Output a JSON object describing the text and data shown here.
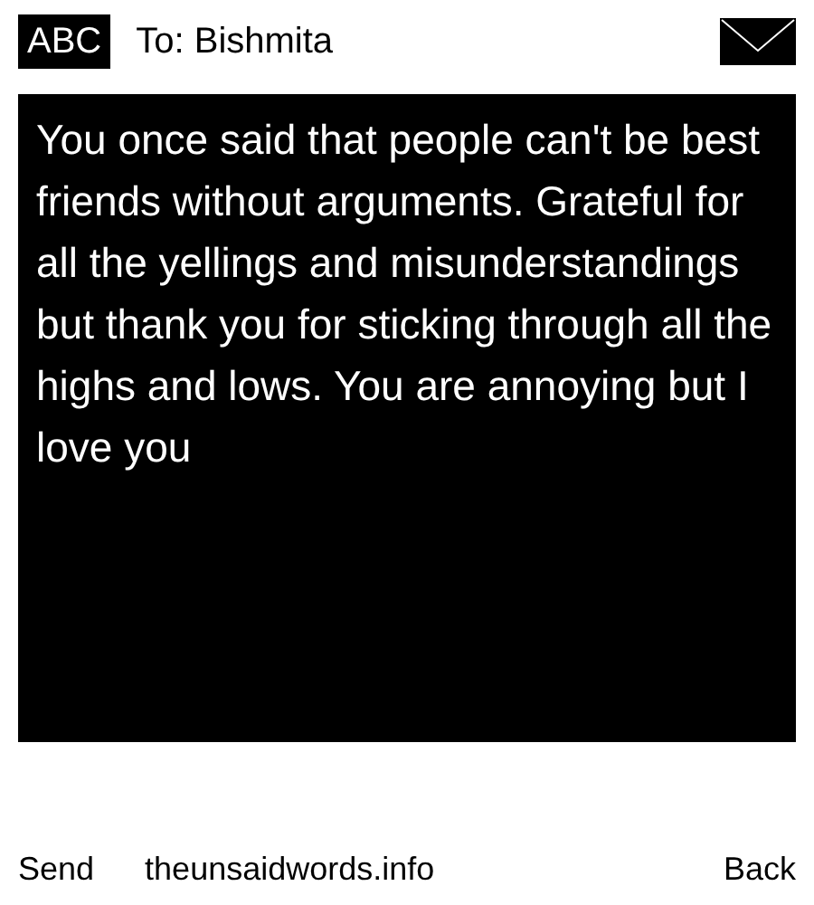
{
  "header": {
    "mode_badge": "ABC",
    "recipient": "To: Bishmita"
  },
  "message": {
    "text": "You once said that people can't be best friends without arguments. Grateful for all the yellings and misunderstandings but thank you for sticking through all the highs and lows. You are annoying but I love you"
  },
  "footer": {
    "left_softkey": "Send",
    "site": "theunsaidwords.info",
    "right_softkey": "Back"
  }
}
